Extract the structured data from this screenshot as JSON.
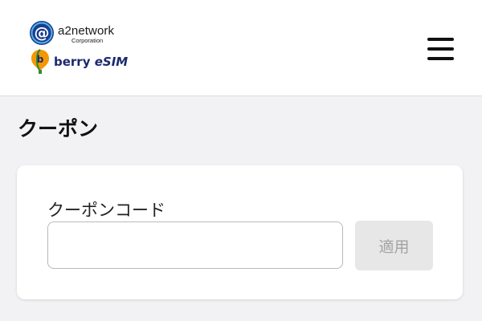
{
  "header": {
    "logo_company": {
      "name": "a2network",
      "sub": "Corporation",
      "icon": "at-sign-logo-icon"
    },
    "logo_brand": {
      "name": "berry",
      "product": "eSIM",
      "icon": "berry-balloon-logo-icon"
    },
    "menu_icon": "hamburger-menu-icon"
  },
  "page": {
    "title": "クーポン"
  },
  "coupon_form": {
    "label": "クーポンコード",
    "input_value": "",
    "apply_label": "適用"
  },
  "colors": {
    "page_background": "#f2f2f4",
    "header_background": "#ffffff",
    "brand_blue": "#1b2a6e",
    "logo_orange": "#f39800",
    "button_disabled_bg": "#e7e7e7",
    "button_disabled_text": "#a3a3a3"
  }
}
